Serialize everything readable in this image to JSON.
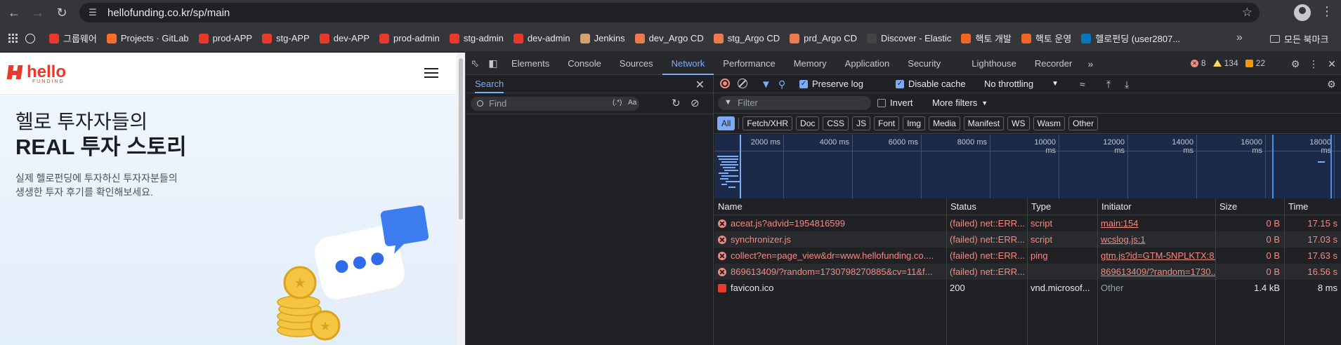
{
  "browser": {
    "url": "hellofunding.co.kr/sp/main",
    "bookmarks": [
      {
        "label": "",
        "color": "#e8eaed"
      },
      {
        "label": "그룹웨어",
        "color": "#e8392b"
      },
      {
        "label": "Projects · GitLab",
        "color": "#fc6d26"
      },
      {
        "label": "prod-APP",
        "color": "#e8392b"
      },
      {
        "label": "stg-APP",
        "color": "#e8392b"
      },
      {
        "label": "dev-APP",
        "color": "#e8392b"
      },
      {
        "label": "prod-admin",
        "color": "#e8392b"
      },
      {
        "label": "stg-admin",
        "color": "#e8392b"
      },
      {
        "label": "dev-admin",
        "color": "#e8392b"
      },
      {
        "label": "Jenkins",
        "color": "#d4a373"
      },
      {
        "label": "dev_Argo CD",
        "color": "#ef7b4d"
      },
      {
        "label": "stg_Argo CD",
        "color": "#ef7b4d"
      },
      {
        "label": "prd_Argo CD",
        "color": "#ef7b4d"
      },
      {
        "label": "Discover - Elastic",
        "color": "#444"
      },
      {
        "label": "핵토 개발",
        "color": "#f26522"
      },
      {
        "label": "핵토 운영",
        "color": "#f26522"
      },
      {
        "label": "헬로펀딩 (user2807...",
        "color": "#0079bf"
      }
    ],
    "bookmarks_folder": "모든 북마크"
  },
  "webpage": {
    "logo_text": "hello",
    "logo_sub": "FUNDING",
    "hero_line1": "헬로 투자자들의",
    "hero_line2": "REAL 투자 스토리",
    "hero_desc1": "실제 헬로펀딩에 투자하신 투자자분들의",
    "hero_desc2": "생생한 투자 후기를 확인해보세요."
  },
  "devtools": {
    "tabs": [
      "Elements",
      "Console",
      "Sources",
      "Network",
      "Performance",
      "Memory",
      "Application",
      "Security",
      "Lighthouse",
      "Recorder"
    ],
    "active_tab": "Network",
    "errors": "8",
    "warnings": "134",
    "infos": "22",
    "search": {
      "title": "Search",
      "placeholder": "Find",
      "regex_label": "(.*)",
      "case_label": "Aa"
    },
    "network": {
      "preserve_log": "Preserve log",
      "disable_cache": "Disable cache",
      "throttling": "No throttling",
      "filter_placeholder": "Filter",
      "invert": "Invert",
      "more_filters": "More filters",
      "types": [
        "All",
        "Fetch/XHR",
        "Doc",
        "CSS",
        "JS",
        "Font",
        "Img",
        "Media",
        "Manifest",
        "WS",
        "Wasm",
        "Other"
      ],
      "timeline_ticks": [
        "2000 ms",
        "4000 ms",
        "6000 ms",
        "8000 ms",
        "10000 ms",
        "12000 ms",
        "14000 ms",
        "16000 ms",
        "18000 ms"
      ],
      "columns": [
        "Name",
        "Status",
        "Type",
        "Initiator",
        "Size",
        "Time"
      ],
      "rows": [
        {
          "name": "aceat.js?advid=1954816599",
          "status": "(failed) net::ERR...",
          "type": "script",
          "initiator": "main:154",
          "size": "0 B",
          "time": "17.15 s",
          "failed": true
        },
        {
          "name": "synchronizer.js",
          "status": "(failed) net::ERR...",
          "type": "script",
          "initiator": "wcslog.js:1",
          "size": "0 B",
          "time": "17.03 s",
          "failed": true
        },
        {
          "name": "collect?en=page_view&dr=www.hellofunding.co....",
          "status": "(failed) net::ERR...",
          "type": "ping",
          "initiator": "gtm.js?id=GTM-5NPLKTX:8...",
          "size": "0 B",
          "time": "17.63 s",
          "failed": true
        },
        {
          "name": "869613409/?random=1730798270885&cv=11&f...",
          "status": "(failed) net::ERR...",
          "type": "",
          "initiator": "869613409/?random=1730...",
          "size": "0 B",
          "time": "16.56 s",
          "failed": true
        },
        {
          "name": "favicon.ico",
          "status": "200",
          "type": "vnd.microsof...",
          "initiator": "Other",
          "size": "1.4 kB",
          "time": "8 ms",
          "failed": false
        }
      ]
    }
  }
}
